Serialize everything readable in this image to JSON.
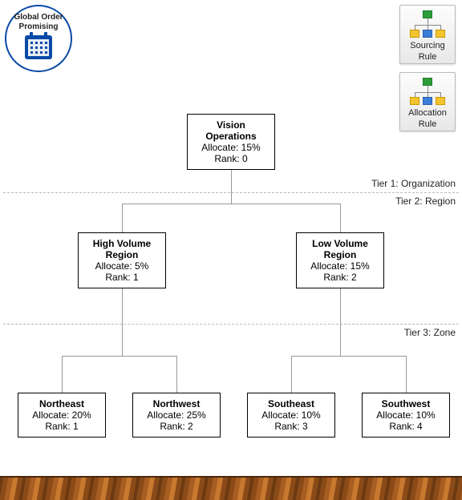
{
  "badge": {
    "line1": "Global Order",
    "line2": "Promising"
  },
  "rules": {
    "sourcing": {
      "line1": "Sourcing",
      "line2": "Rule"
    },
    "allocation": {
      "line1": "Allocation",
      "line2": "Rule"
    }
  },
  "tiers": {
    "t1": "Tier 1: Organization",
    "t2": "Tier 2: Region",
    "t3": "Tier 3: Zone"
  },
  "labels": {
    "allocate_prefix": "Allocate: ",
    "rank_prefix": "Rank: "
  },
  "nodes": {
    "root": {
      "name": "Vision Operations",
      "allocate": "Allocate: 15%",
      "rank": "Rank: 0"
    },
    "hv": {
      "name1": "High Volume",
      "name2": "Region",
      "allocate": "Allocate: 5%",
      "rank": "Rank: 1"
    },
    "lv": {
      "name1": "Low Volume",
      "name2": "Region",
      "allocate": "Allocate: 15%",
      "rank": "Rank: 2"
    },
    "ne": {
      "name": "Northeast",
      "allocate": "Allocate: 20%",
      "rank": "Rank: 1"
    },
    "nw": {
      "name": "Northwest",
      "allocate": "Allocate: 25%",
      "rank": "Rank: 2"
    },
    "se": {
      "name": "Southeast",
      "allocate": "Allocate: 10%",
      "rank": "Rank: 3"
    },
    "sw": {
      "name": "Southwest",
      "allocate": "Allocate: 10%",
      "rank": "Rank: 4"
    }
  }
}
